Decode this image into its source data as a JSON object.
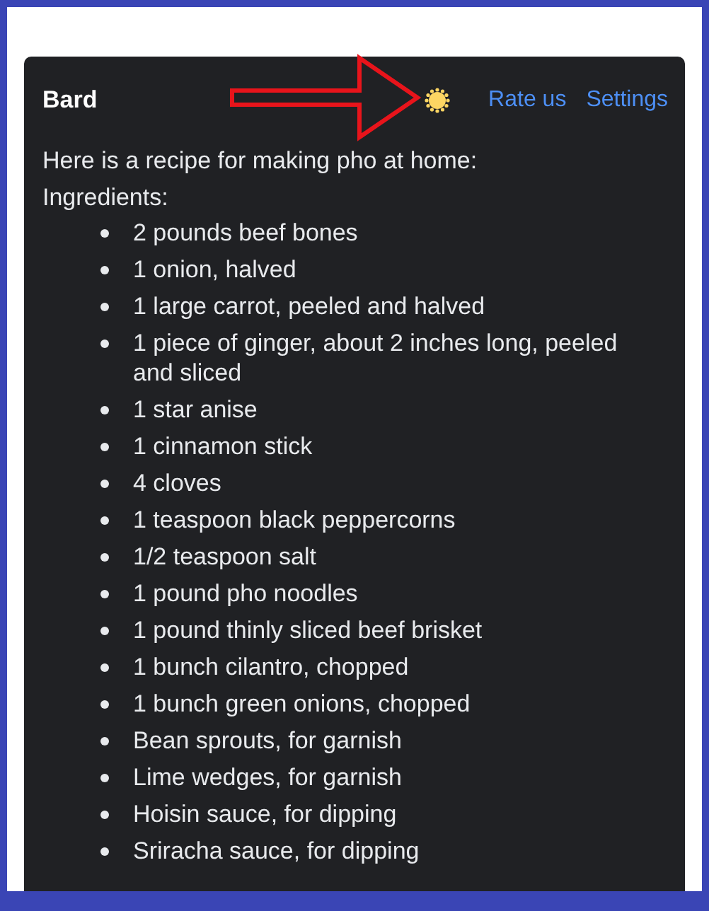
{
  "header": {
    "title": "Bard",
    "links": [
      "Rate us",
      "Settings"
    ]
  },
  "intro": "Here is a recipe for making pho at home:",
  "section": "Ingredients:",
  "ingredients": [
    "2 pounds beef bones",
    "1 onion, halved",
    "1 large carrot, peeled and halved",
    "1 piece of ginger, about 2 inches long, peeled and sliced",
    "1 star anise",
    "1 cinnamon stick",
    "4 cloves",
    "1 teaspoon black peppercorns",
    "1/2 teaspoon salt",
    "1 pound pho noodles",
    "1 pound thinly sliced beef brisket",
    "1 bunch cilantro, chopped",
    "1 bunch green onions, chopped",
    "Bean sprouts, for garnish",
    "Lime wedges, for garnish",
    "Hoisin sauce, for dipping",
    "Sriracha sauce, for dipping"
  ]
}
